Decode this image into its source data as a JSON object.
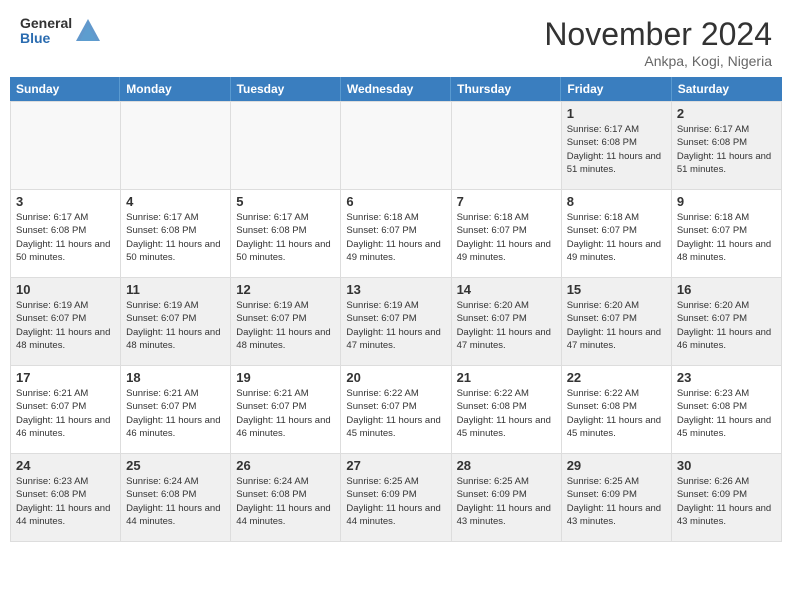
{
  "logo": {
    "general": "General",
    "blue": "Blue"
  },
  "title": "November 2024",
  "location": "Ankpa, Kogi, Nigeria",
  "days_of_week": [
    "Sunday",
    "Monday",
    "Tuesday",
    "Wednesday",
    "Thursday",
    "Friday",
    "Saturday"
  ],
  "weeks": [
    [
      {
        "day": "",
        "empty": true
      },
      {
        "day": "",
        "empty": true
      },
      {
        "day": "",
        "empty": true
      },
      {
        "day": "",
        "empty": true
      },
      {
        "day": "",
        "empty": true
      },
      {
        "day": "1",
        "sunrise": "Sunrise: 6:17 AM",
        "sunset": "Sunset: 6:08 PM",
        "daylight": "Daylight: 11 hours and 51 minutes."
      },
      {
        "day": "2",
        "sunrise": "Sunrise: 6:17 AM",
        "sunset": "Sunset: 6:08 PM",
        "daylight": "Daylight: 11 hours and 51 minutes."
      }
    ],
    [
      {
        "day": "3",
        "sunrise": "Sunrise: 6:17 AM",
        "sunset": "Sunset: 6:08 PM",
        "daylight": "Daylight: 11 hours and 50 minutes."
      },
      {
        "day": "4",
        "sunrise": "Sunrise: 6:17 AM",
        "sunset": "Sunset: 6:08 PM",
        "daylight": "Daylight: 11 hours and 50 minutes."
      },
      {
        "day": "5",
        "sunrise": "Sunrise: 6:17 AM",
        "sunset": "Sunset: 6:08 PM",
        "daylight": "Daylight: 11 hours and 50 minutes."
      },
      {
        "day": "6",
        "sunrise": "Sunrise: 6:18 AM",
        "sunset": "Sunset: 6:07 PM",
        "daylight": "Daylight: 11 hours and 49 minutes."
      },
      {
        "day": "7",
        "sunrise": "Sunrise: 6:18 AM",
        "sunset": "Sunset: 6:07 PM",
        "daylight": "Daylight: 11 hours and 49 minutes."
      },
      {
        "day": "8",
        "sunrise": "Sunrise: 6:18 AM",
        "sunset": "Sunset: 6:07 PM",
        "daylight": "Daylight: 11 hours and 49 minutes."
      },
      {
        "day": "9",
        "sunrise": "Sunrise: 6:18 AM",
        "sunset": "Sunset: 6:07 PM",
        "daylight": "Daylight: 11 hours and 48 minutes."
      }
    ],
    [
      {
        "day": "10",
        "sunrise": "Sunrise: 6:19 AM",
        "sunset": "Sunset: 6:07 PM",
        "daylight": "Daylight: 11 hours and 48 minutes."
      },
      {
        "day": "11",
        "sunrise": "Sunrise: 6:19 AM",
        "sunset": "Sunset: 6:07 PM",
        "daylight": "Daylight: 11 hours and 48 minutes."
      },
      {
        "day": "12",
        "sunrise": "Sunrise: 6:19 AM",
        "sunset": "Sunset: 6:07 PM",
        "daylight": "Daylight: 11 hours and 48 minutes."
      },
      {
        "day": "13",
        "sunrise": "Sunrise: 6:19 AM",
        "sunset": "Sunset: 6:07 PM",
        "daylight": "Daylight: 11 hours and 47 minutes."
      },
      {
        "day": "14",
        "sunrise": "Sunrise: 6:20 AM",
        "sunset": "Sunset: 6:07 PM",
        "daylight": "Daylight: 11 hours and 47 minutes."
      },
      {
        "day": "15",
        "sunrise": "Sunrise: 6:20 AM",
        "sunset": "Sunset: 6:07 PM",
        "daylight": "Daylight: 11 hours and 47 minutes."
      },
      {
        "day": "16",
        "sunrise": "Sunrise: 6:20 AM",
        "sunset": "Sunset: 6:07 PM",
        "daylight": "Daylight: 11 hours and 46 minutes."
      }
    ],
    [
      {
        "day": "17",
        "sunrise": "Sunrise: 6:21 AM",
        "sunset": "Sunset: 6:07 PM",
        "daylight": "Daylight: 11 hours and 46 minutes."
      },
      {
        "day": "18",
        "sunrise": "Sunrise: 6:21 AM",
        "sunset": "Sunset: 6:07 PM",
        "daylight": "Daylight: 11 hours and 46 minutes."
      },
      {
        "day": "19",
        "sunrise": "Sunrise: 6:21 AM",
        "sunset": "Sunset: 6:07 PM",
        "daylight": "Daylight: 11 hours and 46 minutes."
      },
      {
        "day": "20",
        "sunrise": "Sunrise: 6:22 AM",
        "sunset": "Sunset: 6:07 PM",
        "daylight": "Daylight: 11 hours and 45 minutes."
      },
      {
        "day": "21",
        "sunrise": "Sunrise: 6:22 AM",
        "sunset": "Sunset: 6:08 PM",
        "daylight": "Daylight: 11 hours and 45 minutes."
      },
      {
        "day": "22",
        "sunrise": "Sunrise: 6:22 AM",
        "sunset": "Sunset: 6:08 PM",
        "daylight": "Daylight: 11 hours and 45 minutes."
      },
      {
        "day": "23",
        "sunrise": "Sunrise: 6:23 AM",
        "sunset": "Sunset: 6:08 PM",
        "daylight": "Daylight: 11 hours and 45 minutes."
      }
    ],
    [
      {
        "day": "24",
        "sunrise": "Sunrise: 6:23 AM",
        "sunset": "Sunset: 6:08 PM",
        "daylight": "Daylight: 11 hours and 44 minutes."
      },
      {
        "day": "25",
        "sunrise": "Sunrise: 6:24 AM",
        "sunset": "Sunset: 6:08 PM",
        "daylight": "Daylight: 11 hours and 44 minutes."
      },
      {
        "day": "26",
        "sunrise": "Sunrise: 6:24 AM",
        "sunset": "Sunset: 6:08 PM",
        "daylight": "Daylight: 11 hours and 44 minutes."
      },
      {
        "day": "27",
        "sunrise": "Sunrise: 6:25 AM",
        "sunset": "Sunset: 6:09 PM",
        "daylight": "Daylight: 11 hours and 44 minutes."
      },
      {
        "day": "28",
        "sunrise": "Sunrise: 6:25 AM",
        "sunset": "Sunset: 6:09 PM",
        "daylight": "Daylight: 11 hours and 43 minutes."
      },
      {
        "day": "29",
        "sunrise": "Sunrise: 6:25 AM",
        "sunset": "Sunset: 6:09 PM",
        "daylight": "Daylight: 11 hours and 43 minutes."
      },
      {
        "day": "30",
        "sunrise": "Sunrise: 6:26 AM",
        "sunset": "Sunset: 6:09 PM",
        "daylight": "Daylight: 11 hours and 43 minutes."
      }
    ]
  ]
}
